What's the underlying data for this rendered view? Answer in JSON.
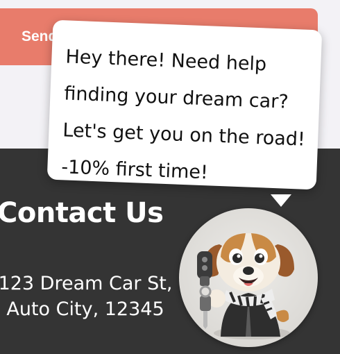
{
  "form": {
    "send_label": "Send Message"
  },
  "chat_widget": {
    "greeting": "Hey there! Need help finding your dream car? Let's get you on the road! -10% first time!",
    "avatar_icon": "dog-mascot-with-car-keys-icon"
  },
  "contact": {
    "title": "Contact Us",
    "address": "123 Dream Car St, Auto City, 12345"
  },
  "colors": {
    "send_button": "#e87c6b",
    "contact_bg": "#343434",
    "page_bg": "#f3f2f6",
    "bubble_bg": "#ffffff"
  }
}
